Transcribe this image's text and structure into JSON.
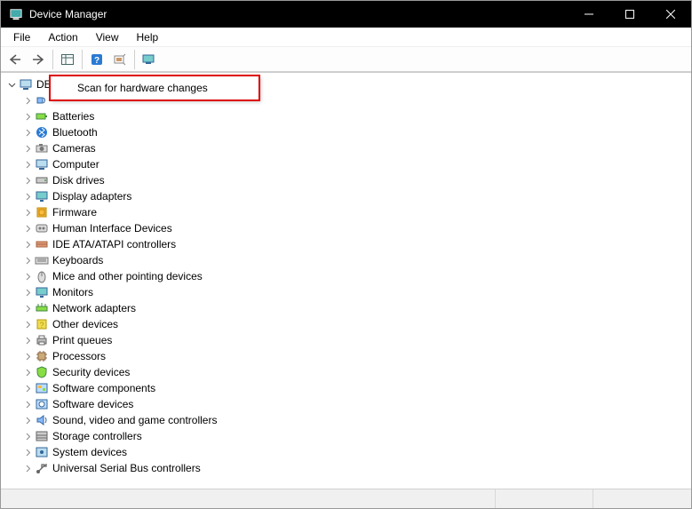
{
  "window": {
    "title": "Device Manager"
  },
  "menu": {
    "file": "File",
    "action": "Action",
    "view": "View",
    "help": "Help"
  },
  "context": {
    "scan": "Scan for hardware changes"
  },
  "tree": {
    "rootLabel": "DE",
    "children": [
      {
        "label": "",
        "icon": "audio"
      },
      {
        "label": "Batteries",
        "icon": "battery"
      },
      {
        "label": "Bluetooth",
        "icon": "bluetooth"
      },
      {
        "label": "Cameras",
        "icon": "camera"
      },
      {
        "label": "Computer",
        "icon": "computer"
      },
      {
        "label": "Disk drives",
        "icon": "disk"
      },
      {
        "label": "Display adapters",
        "icon": "display"
      },
      {
        "label": "Firmware",
        "icon": "firmware"
      },
      {
        "label": "Human Interface Devices",
        "icon": "hid"
      },
      {
        "label": "IDE ATA/ATAPI controllers",
        "icon": "ide"
      },
      {
        "label": "Keyboards",
        "icon": "keyboard"
      },
      {
        "label": "Mice and other pointing devices",
        "icon": "mouse"
      },
      {
        "label": "Monitors",
        "icon": "monitor"
      },
      {
        "label": "Network adapters",
        "icon": "network"
      },
      {
        "label": "Other devices",
        "icon": "other"
      },
      {
        "label": "Print queues",
        "icon": "print"
      },
      {
        "label": "Processors",
        "icon": "cpu"
      },
      {
        "label": "Security devices",
        "icon": "security"
      },
      {
        "label": "Software components",
        "icon": "swcomp"
      },
      {
        "label": "Software devices",
        "icon": "swdev"
      },
      {
        "label": "Sound, video and game controllers",
        "icon": "sound"
      },
      {
        "label": "Storage controllers",
        "icon": "storage"
      },
      {
        "label": "System devices",
        "icon": "system"
      },
      {
        "label": "Universal Serial Bus controllers",
        "icon": "usb"
      }
    ]
  }
}
